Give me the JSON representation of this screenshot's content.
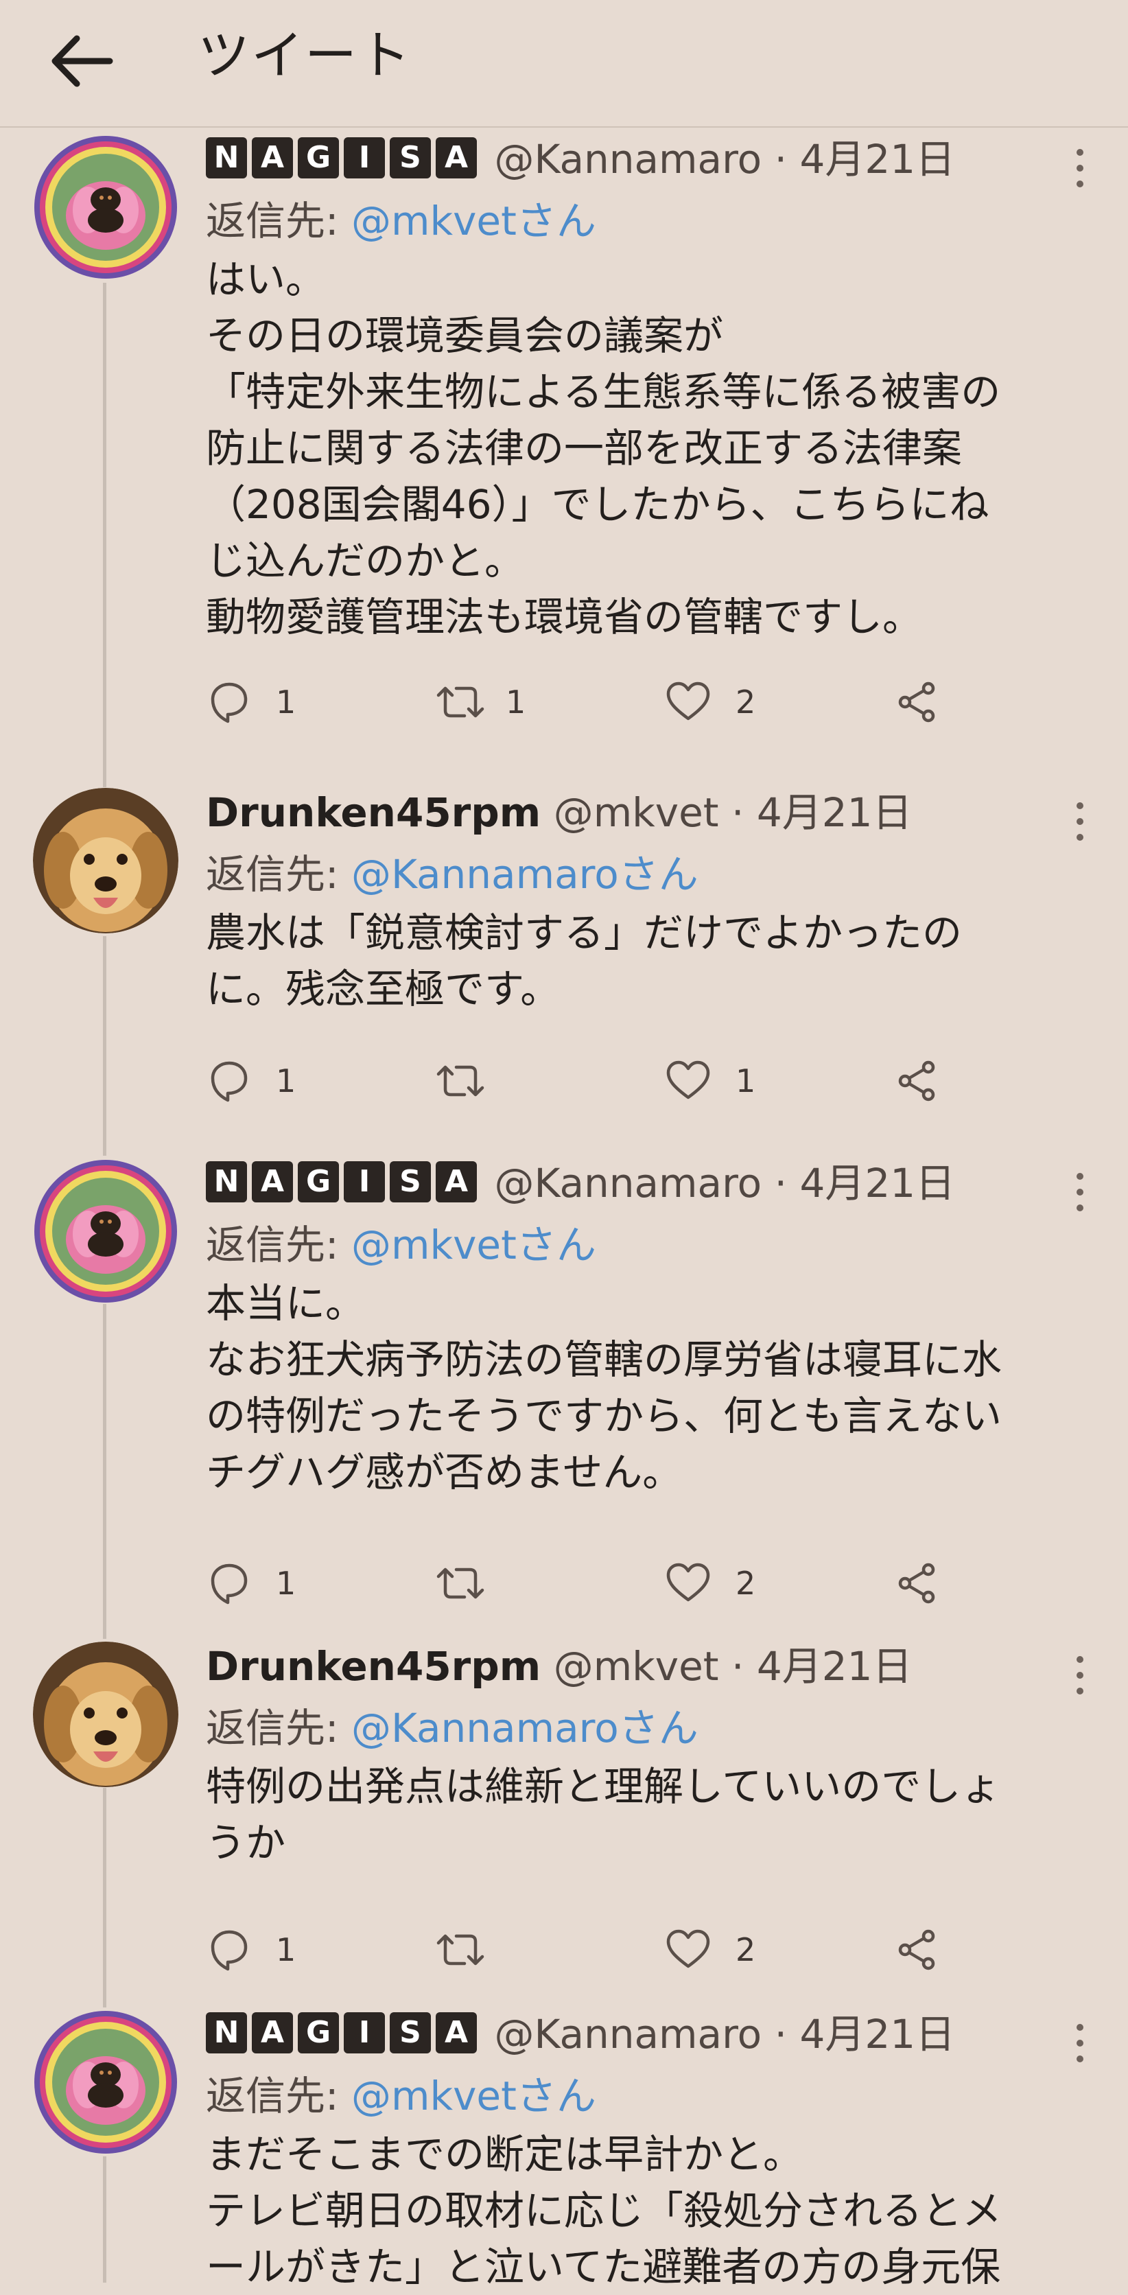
{
  "header": {
    "title": "ツイート",
    "back_icon": "back-arrow-icon"
  },
  "colors": {
    "background": "#e7dbd2",
    "link": "#4d8ccb",
    "text": "#231f1d"
  },
  "tweets": [
    {
      "display_name": "NAGISA",
      "handle": "@Kannamaro",
      "date": "4月21日",
      "reply_label": "返信先:",
      "reply_to": "@mkvetさん",
      "lines": [
        "はい。",
        "その日の環境委員会の議案が",
        "「特定外来生物による生態系等に係る被害の",
        "防止に関する法律の一部を改正する法律案",
        "（208国会閣46）」でしたから、こちらにね",
        "じ込んだのかと。",
        "動物愛護管理法も環境省の管轄ですし。"
      ],
      "reply_count": "1",
      "retweet_count": "1",
      "like_count": "2"
    },
    {
      "display_name": "Drunken45rpm",
      "handle": "@mkvet",
      "date": "4月21日",
      "reply_label": "返信先:",
      "reply_to": "@Kannamaroさん",
      "lines": [
        "農水は「鋭意検討する」だけでよかったの",
        "に。残念至極です。"
      ],
      "reply_count": "1",
      "retweet_count": "",
      "like_count": "1"
    },
    {
      "display_name": "NAGISA",
      "handle": "@Kannamaro",
      "date": "4月21日",
      "reply_label": "返信先:",
      "reply_to": "@mkvetさん",
      "lines": [
        "本当に。",
        "なお狂犬病予防法の管轄の厚労省は寝耳に水",
        "の特例だったそうですから、何とも言えない",
        "チグハグ感が否めません。"
      ],
      "reply_count": "1",
      "retweet_count": "",
      "like_count": "2"
    },
    {
      "display_name": "Drunken45rpm",
      "handle": "@mkvet",
      "date": "4月21日",
      "reply_label": "返信先:",
      "reply_to": "@Kannamaroさん",
      "lines": [
        "特例の出発点は維新と理解していいのでしょ",
        "うか"
      ],
      "reply_count": "1",
      "retweet_count": "",
      "like_count": "2"
    },
    {
      "display_name": "NAGISA",
      "handle": "@Kannamaro",
      "date": "4月21日",
      "reply_label": "返信先:",
      "reply_to": "@mkvetさん",
      "lines": [
        "まだそこまでの断定は早計かと。",
        "テレビ朝日の取材に応じ「殺処分されるとメ",
        "ールがきた」と泣いてた避難者の方の身元保"
      ],
      "reply_count": "",
      "retweet_count": "",
      "like_count": ""
    }
  ]
}
